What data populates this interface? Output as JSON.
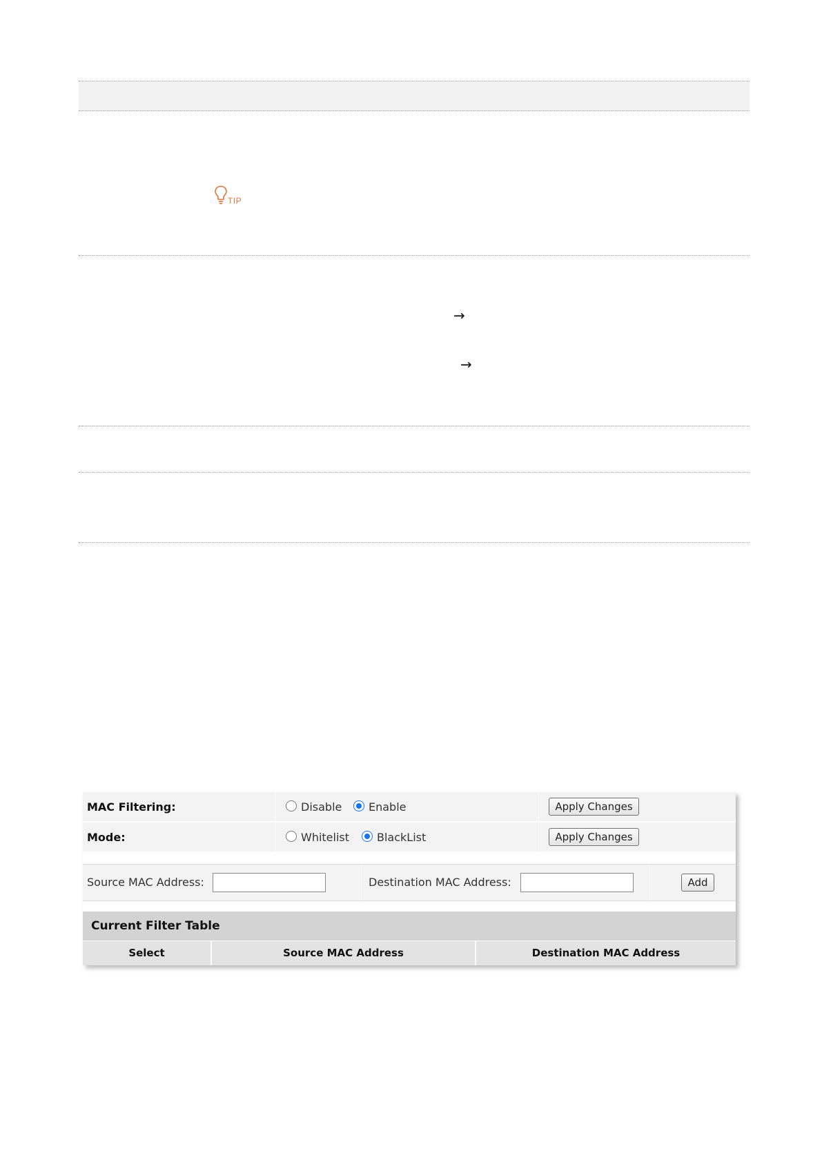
{
  "tip": {
    "label": "TIP",
    "icon": "lightbulb-icon",
    "color": "#e2733a"
  },
  "arrows": [
    "→",
    "→"
  ],
  "mac_filter": {
    "filtering_label": "MAC Filtering:",
    "filtering_options": [
      "Disable",
      "Enable"
    ],
    "filtering_selected": "Enable",
    "mode_label": "Mode:",
    "mode_options": [
      "Whitelist",
      "BlackList"
    ],
    "mode_selected": "BlackList",
    "apply_label": "Apply Changes",
    "source_label": "Source MAC Address:",
    "source_value": "",
    "destination_label": "Destination MAC Address:",
    "destination_value": "",
    "add_label": "Add",
    "table_title": "Current Filter Table",
    "columns": [
      "Select",
      "Source MAC Address",
      "Destination MAC Address"
    ],
    "accent_color": "#1a73e8"
  }
}
